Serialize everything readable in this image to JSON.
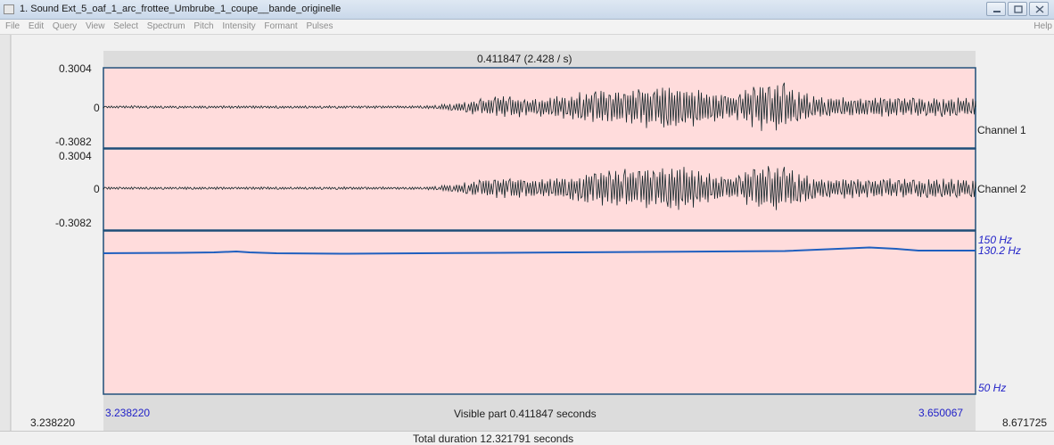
{
  "window": {
    "title": "1. Sound Ext_5_oaf_1_arc_frottee_Umbrube_1_coupe__bande_originelle"
  },
  "menu": {
    "items": [
      "File",
      "Edit",
      "Query",
      "View",
      "Select",
      "Spectrum",
      "Pitch",
      "Intensity",
      "Formant",
      "Pulses"
    ],
    "help": "Help"
  },
  "editor": {
    "selection_label": "0.411847 (2.428 / s)",
    "channels": [
      {
        "name": "Channel 1",
        "max": "0.3004",
        "zero": "0",
        "min": "-0.3082"
      },
      {
        "name": "Channel 2",
        "max": "0.3004",
        "zero": "0",
        "min": "-0.3082"
      }
    ],
    "pitch": {
      "top": "150 Hz",
      "current": "130.2 Hz",
      "bottom": "50 Hz"
    },
    "view_start": "3.238220",
    "view_end": "3.650067",
    "visible_part": "Visible part 0.411847 seconds",
    "left_total": "3.238220",
    "right_total": "8.671725",
    "total_duration": "Total duration 12.321791 seconds"
  },
  "colors": {
    "background_pink": "#ffdcdc",
    "border_blue": "#1f4e79",
    "waveform": "#15262a",
    "pitch_line": "#1f5fbf",
    "label_blue": "#2222c8"
  }
}
